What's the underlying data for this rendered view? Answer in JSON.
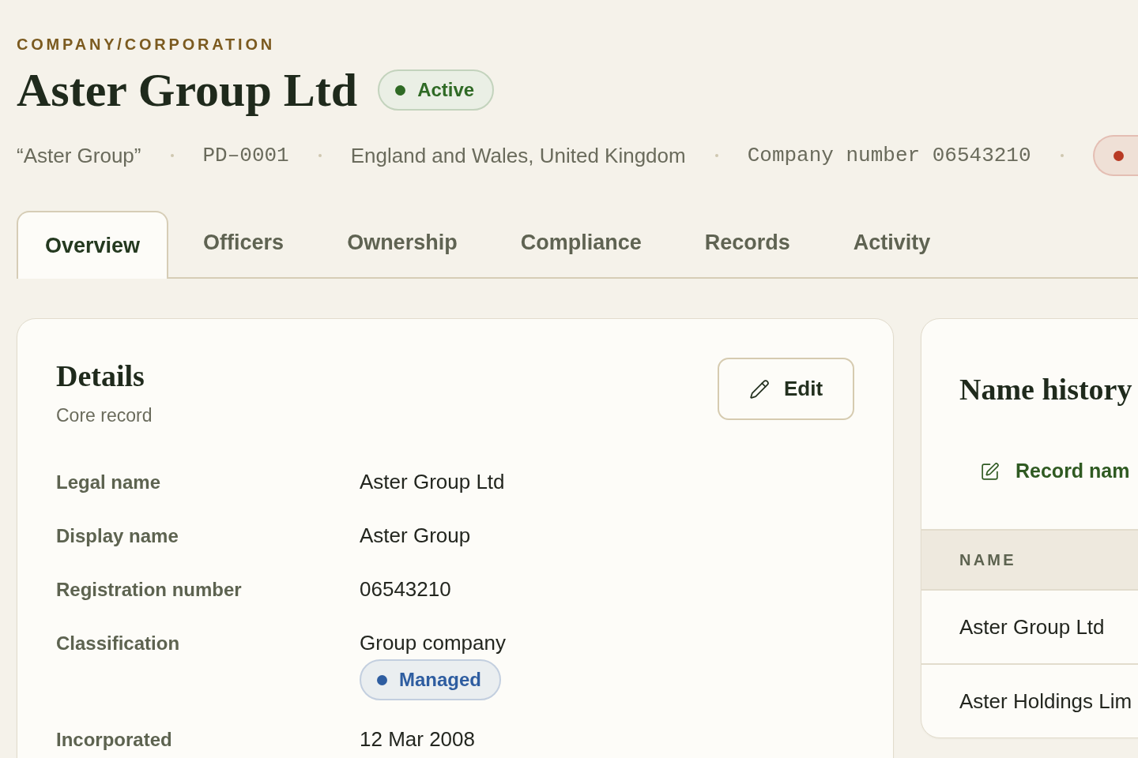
{
  "header": {
    "kicker": "COMPANY/CORPORATION",
    "title": "Aster Group Ltd",
    "status": {
      "label": "Active",
      "color": "#2f6a25"
    }
  },
  "meta": [
    {
      "kind": "text",
      "text": "“Aster Group”"
    },
    {
      "kind": "code",
      "text": "PD–0001"
    },
    {
      "kind": "text",
      "text": "England and Wales, United Kingdom"
    },
    {
      "kind": "code",
      "text": "Company number 06543210"
    },
    {
      "kind": "badge",
      "color": "#b83a24"
    }
  ],
  "tabs": [
    {
      "label": "Overview",
      "selected": true
    },
    {
      "label": "Officers",
      "selected": false
    },
    {
      "label": "Ownership",
      "selected": false
    },
    {
      "label": "Compliance",
      "selected": false
    },
    {
      "label": "Records",
      "selected": false
    },
    {
      "label": "Activity",
      "selected": false
    }
  ],
  "details": {
    "title": "Details",
    "subtitle": "Core record",
    "edit_button": "Edit",
    "rows": [
      {
        "label": "Legal name",
        "value": "Aster Group Ltd"
      },
      {
        "label": "Display name",
        "value": "Aster Group"
      },
      {
        "label": "Registration number",
        "value": "06543210"
      },
      {
        "label": "Classification",
        "value": "Group company",
        "badge": {
          "label": "Managed",
          "color": "#2e5da0"
        }
      },
      {
        "label": "Incorporated",
        "value": "12 Mar 2008"
      }
    ]
  },
  "name_history": {
    "title": "Name history",
    "record_button": "Record nam",
    "table": {
      "columns": [
        "NAME"
      ],
      "rows": [
        "Aster Group Ltd",
        "Aster Holdings Lim"
      ]
    }
  }
}
